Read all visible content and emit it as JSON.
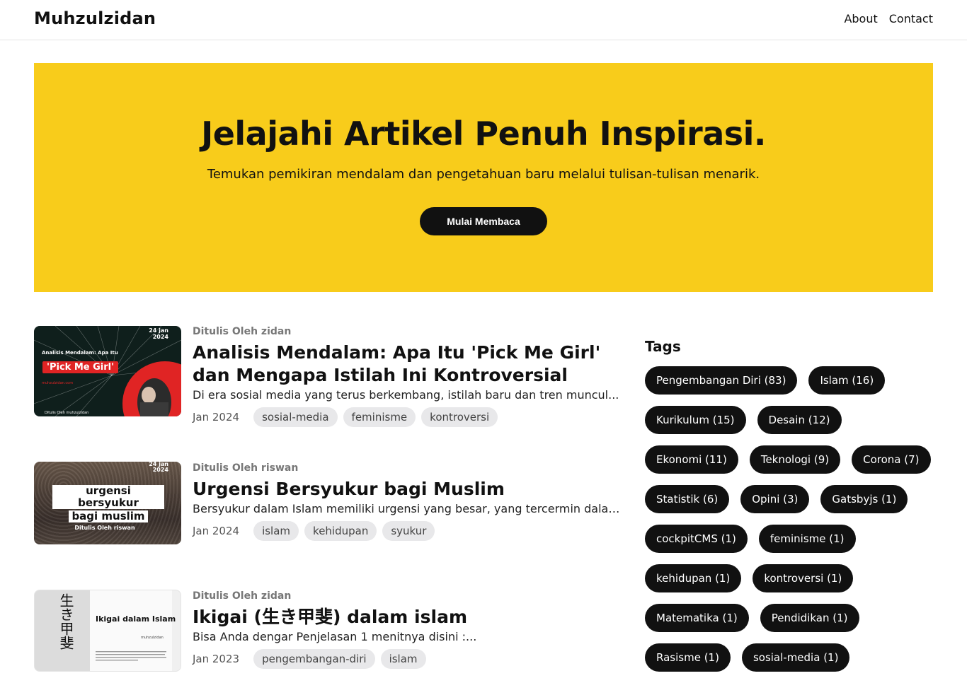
{
  "header": {
    "brand": "Muhzulzidan",
    "nav": [
      "About",
      "Contact"
    ]
  },
  "hero": {
    "title": "Jelajahi Artikel Penuh Inspirasi.",
    "subtitle": "Temukan pemikiran mendalam dan pengetahuan baru melalui tulisan-tulisan menarik.",
    "cta": "Mulai Membaca",
    "background_color": "#f8cc1b"
  },
  "articles": [
    {
      "author": "Ditulis Oleh zidan",
      "title": "Analisis Mendalam: Apa Itu 'Pick Me Girl' dan Mengapa Istilah Ini Kontroversial",
      "excerpt": "Di era sosial media yang terus berkembang, istilah baru dan tren muncul...",
      "date": "Jan 2024",
      "tags": [
        "sosial-media",
        "feminisme",
        "kontroversi"
      ],
      "thumb": {
        "date_line1": "24 jan",
        "date_line2": "2024",
        "subtitle": "Analisis Mendalam: Apa Itu",
        "highlight": "'Pick Me Girl'",
        "url": "muhzulzidan.com",
        "footer": "Ditulis Oleh muhzulzidan"
      }
    },
    {
      "author": "Ditulis Oleh riswan",
      "title": "Urgensi Bersyukur bagi Muslim",
      "excerpt": "Bersyukur dalam Islam memiliki urgensi yang besar, yang tercermin dalam...",
      "date": "Jan 2024",
      "tags": [
        "islam",
        "kehidupan",
        "syukur"
      ],
      "thumb": {
        "date_line1": "24 jan",
        "date_line2": "2024",
        "line1": "urgensi bersyukur",
        "line2": "bagi muslim",
        "footer": "Ditulis Oleh riswan"
      }
    },
    {
      "author": "Ditulis Oleh zidan",
      "title": "Ikigai (生き甲斐) dalam islam",
      "excerpt": "Bisa Anda dengar Penjelasan 1 menitnya disini :...",
      "date": "Jan 2023",
      "tags": [
        "pengembangan-diri",
        "islam"
      ],
      "thumb": {
        "kanji": "生き甲斐",
        "title": "Ikigai dalam Islam",
        "sub": "muhzulzidan"
      }
    }
  ],
  "sidebar": {
    "heading": "Tags",
    "tags": [
      "Pengembangan Diri (83)",
      "Islam (16)",
      "Kurikulum (15)",
      "Desain (12)",
      "Ekonomi (11)",
      "Teknologi (9)",
      "Corona (7)",
      "Statistik (6)",
      "Opini (3)",
      "Gatsbyjs (1)",
      "cockpitCMS (1)",
      "feminisme (1)",
      "kehidupan (1)",
      "kontroversi (1)",
      "Matematika (1)",
      "Pendidikan (1)",
      "Rasisme (1)",
      "sosial-media (1)"
    ]
  }
}
